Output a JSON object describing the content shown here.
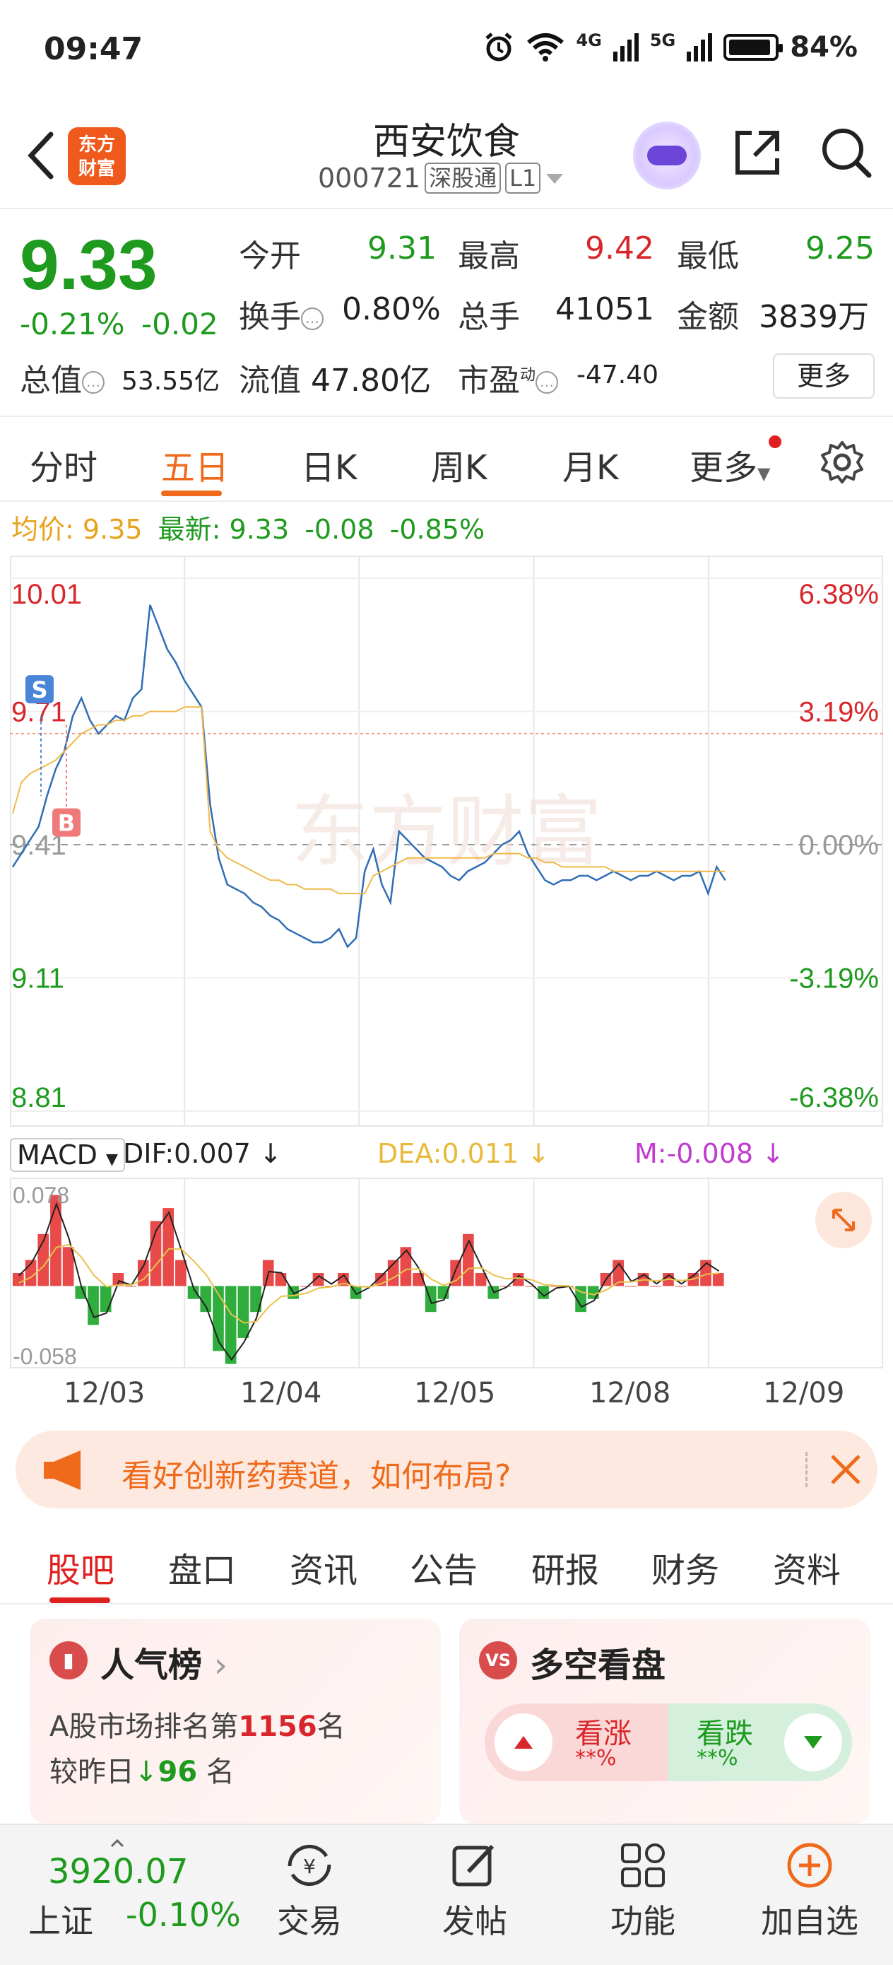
{
  "status_bar": {
    "time": "09:47",
    "network_4g": "4G",
    "network_5g": "5G",
    "battery": "84%",
    "icons": [
      "alarm-icon",
      "wifi-icon",
      "signal-4g-icon",
      "signal-5g-icon",
      "battery-icon"
    ]
  },
  "header": {
    "logo_line1": "东方",
    "logo_line2": "财富",
    "stock_name": "西安饮食",
    "stock_code": "000721",
    "exchange_tag": "深股通",
    "level_tag": "L1"
  },
  "quote": {
    "price": "9.33",
    "change_pct": "-0.21%",
    "change_abs": "-0.02",
    "row1": [
      {
        "label": "今开",
        "value": "9.31",
        "color": "green"
      },
      {
        "label": "最高",
        "value": "9.42",
        "color": "red"
      },
      {
        "label": "最低",
        "value": "9.25",
        "color": "green"
      }
    ],
    "row2": [
      {
        "label": "换手",
        "value": "0.80%"
      },
      {
        "label": "总手",
        "value": "41051"
      },
      {
        "label": "金额",
        "value": "3839万"
      }
    ],
    "total_value_label": "总值",
    "total_value": "53.55亿",
    "float_value_label": "流值",
    "float_value": "47.80亿",
    "pe_label": "市盈",
    "pe_sup": "动",
    "pe_value": "-47.40",
    "more_button": "更多"
  },
  "period_tabs": {
    "items": [
      "分时",
      "五日",
      "日K",
      "周K",
      "月K",
      "更多"
    ],
    "active": "五日"
  },
  "info_line": {
    "avg_label": "均价:",
    "avg_value": "9.35",
    "latest_label": "最新:",
    "latest_value": "9.33",
    "latest_change": "-0.08",
    "latest_pct": "-0.85%"
  },
  "chart_data": {
    "type": "line",
    "title": "",
    "y_left_ticks": [
      "10.01",
      "9.71",
      "9.41",
      "9.11",
      "8.81"
    ],
    "y_right_ticks": [
      "6.38%",
      "3.19%",
      "0.00%",
      "-3.19%",
      "-6.38%"
    ],
    "ylim": [
      8.81,
      10.01
    ],
    "prev_close": 9.41,
    "x_days": [
      "12/03",
      "12/04",
      "12/05",
      "12/08",
      "12/09"
    ],
    "series": [
      {
        "name": "price",
        "color": "#2f6db5",
        "values": [
          9.36,
          9.39,
          9.42,
          9.45,
          9.52,
          9.58,
          9.62,
          9.7,
          9.74,
          9.69,
          9.66,
          9.68,
          9.7,
          9.69,
          9.74,
          9.76,
          9.95,
          9.9,
          9.85,
          9.82,
          9.78,
          9.75,
          9.72,
          9.5,
          9.38,
          9.32,
          9.31,
          9.3,
          9.28,
          9.27,
          9.25,
          9.24,
          9.22,
          9.21,
          9.2,
          9.19,
          9.19,
          9.2,
          9.22,
          9.18,
          9.2,
          9.35,
          9.4,
          9.32,
          9.28,
          9.44,
          9.42,
          9.4,
          9.38,
          9.37,
          9.36,
          9.34,
          9.33,
          9.35,
          9.36,
          9.37,
          9.39,
          9.41,
          9.42,
          9.44,
          9.39,
          9.36,
          9.33,
          9.32,
          9.33,
          9.33,
          9.34,
          9.34,
          9.33,
          9.34,
          9.35,
          9.34,
          9.33,
          9.34,
          9.34,
          9.35,
          9.34,
          9.33,
          9.34,
          9.34,
          9.35,
          9.3,
          9.36,
          9.33
        ]
      },
      {
        "name": "avg",
        "color": "#f0b94a",
        "values": [
          9.48,
          9.55,
          9.57,
          9.58,
          9.59,
          9.6,
          9.62,
          9.64,
          9.66,
          9.67,
          9.68,
          9.68,
          9.69,
          9.69,
          9.7,
          9.7,
          9.71,
          9.71,
          9.71,
          9.71,
          9.72,
          9.72,
          9.72,
          9.44,
          9.4,
          9.38,
          9.37,
          9.36,
          9.35,
          9.34,
          9.33,
          9.33,
          9.32,
          9.32,
          9.31,
          9.31,
          9.31,
          9.31,
          9.3,
          9.3,
          9.3,
          9.3,
          9.34,
          9.35,
          9.36,
          9.37,
          9.38,
          9.38,
          9.38,
          9.38,
          9.38,
          9.38,
          9.38,
          9.38,
          9.38,
          9.38,
          9.39,
          9.39,
          9.39,
          9.39,
          9.38,
          9.38,
          9.37,
          9.37,
          9.36,
          9.36,
          9.36,
          9.36,
          9.36,
          9.36,
          9.35,
          9.35,
          9.35,
          9.35,
          9.35,
          9.35,
          9.35,
          9.35,
          9.35,
          9.35,
          9.35,
          9.35,
          9.35,
          9.35
        ]
      }
    ],
    "markers": [
      {
        "label": "S",
        "color": "#4a86d8"
      },
      {
        "label": "B",
        "color": "#f07a7a"
      }
    ],
    "watermark": "东方财富"
  },
  "macd": {
    "selector": "MACD",
    "dif_label": "DIF:0.007",
    "dea_label": "DEA:0.011",
    "m_label": "M:-0.008",
    "top_tick": "0.078",
    "bottom_tick": "-0.058",
    "colors": {
      "dif": "#222222",
      "dea": "#e8c24a",
      "m": "#c13bd1"
    },
    "histogram": [
      0.01,
      0.02,
      0.04,
      0.07,
      0.03,
      -0.01,
      -0.03,
      -0.02,
      0.01,
      0.0,
      0.02,
      0.05,
      0.06,
      0.02,
      -0.01,
      -0.02,
      -0.05,
      -0.06,
      -0.04,
      -0.02,
      0.02,
      0.01,
      -0.01,
      0.0,
      0.01,
      0.0,
      0.01,
      -0.01,
      0.0,
      0.01,
      0.02,
      0.03,
      0.01,
      -0.02,
      -0.01,
      0.02,
      0.04,
      0.01,
      -0.01,
      0.0,
      0.01,
      0.0,
      -0.01,
      0.0,
      0.0,
      -0.02,
      -0.01,
      0.01,
      0.02,
      0.0,
      0.01,
      0.0,
      0.01,
      0.0,
      0.01,
      0.02,
      0.01
    ]
  },
  "banner": {
    "text": "看好创新药赛道，如何布局?"
  },
  "sub_tabs": {
    "items": [
      "股吧",
      "盘口",
      "资讯",
      "公告",
      "研报",
      "财务",
      "资料"
    ],
    "active": "股吧"
  },
  "cards": {
    "popularity": {
      "title": "人气榜",
      "rank_prefix": "A股市场排名第",
      "rank_value": "1156",
      "rank_suffix": "名",
      "compare_prefix": "较昨日",
      "compare_value": "96",
      "compare_suffix": "名"
    },
    "sentiment": {
      "title": "多空看盘",
      "bull_label": "看涨",
      "bull_value": "**%",
      "bear_label": "看跌",
      "bear_value": "**%"
    }
  },
  "bottom_nav": {
    "index_value": "3920.07",
    "index_name": "上证",
    "index_change": "-0.10%",
    "items": [
      "交易",
      "发帖",
      "功能",
      "加自选"
    ]
  }
}
